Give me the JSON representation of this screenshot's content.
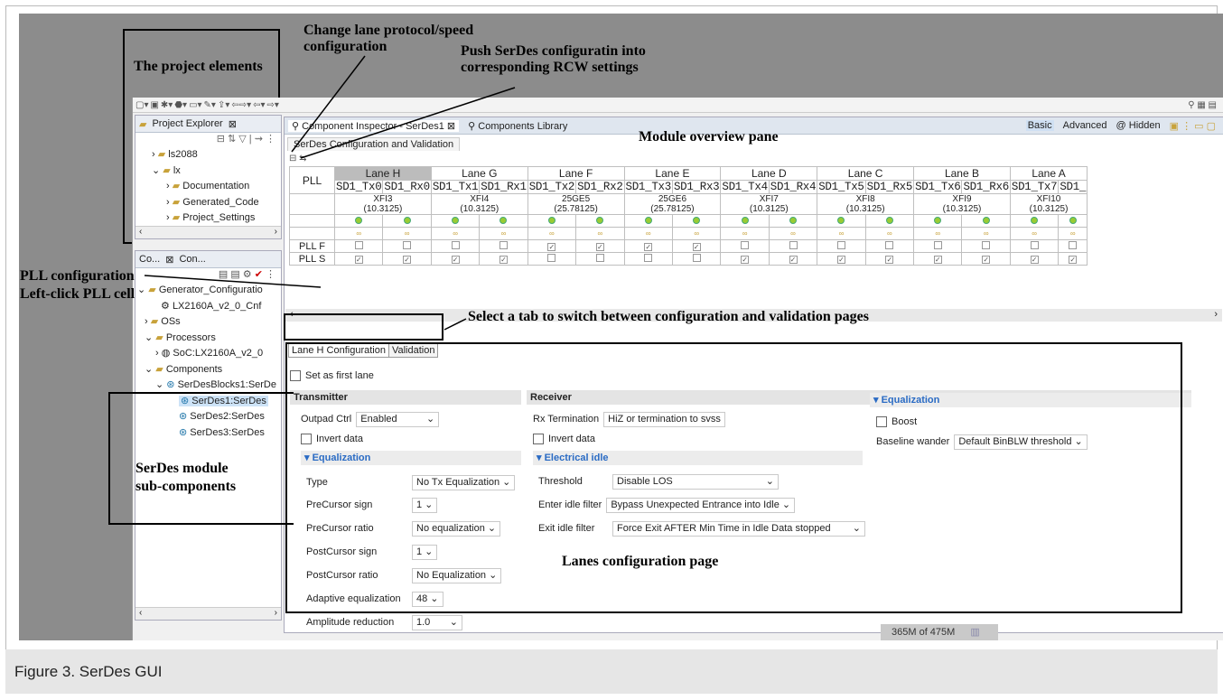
{
  "annotations": {
    "project_elements": "The project elements",
    "change_lane": "Change lane protocol/speed\nconfiguration",
    "push_serdes": "Push SerDes configuratin into\ncorresponding RCW settings",
    "module_overview": "Module overview pane",
    "pll_config": "PLL configuration\nLeft-click PLL cell",
    "select_tab": "Select a tab to switch between configuration and validation pages",
    "serdes_sub": "SerDes module\nsub-components",
    "lanes_page": "Lanes configuration page"
  },
  "project_explorer": {
    "tab_label": "Project Explorer",
    "items": [
      "ls2088",
      "lx",
      "Documentation",
      "Generated_Code",
      "Project_Settings"
    ]
  },
  "components_panel": {
    "tab1": "Co...",
    "tab2": "Con...",
    "items": [
      "Generator_Configuratio",
      "LX2160A_v2_0_Cnf",
      "OSs",
      "Processors",
      "SoC:LX2160A_v2_0",
      "Components",
      "SerDesBlocks1:SerDe",
      "SerDes1:SerDes",
      "SerDes2:SerDes",
      "SerDes3:SerDes"
    ]
  },
  "editor": {
    "tab_inspector": "Component Inspector - SerDes1",
    "tab_library": "Components Library",
    "view_basic": "Basic",
    "view_advanced": "Advanced",
    "view_hidden": "@ Hidden",
    "page_tab": "SerDes Configuration and Validation"
  },
  "pll_table": {
    "pll_header": "PLL",
    "lanes": [
      {
        "name": "Lane H",
        "tx": "SD1_Tx0",
        "rx": "SD1_Rx0",
        "proto": "XFI3",
        "speed": "(10.3125)",
        "pllf": [
          false,
          false
        ],
        "plls": [
          true,
          true
        ]
      },
      {
        "name": "Lane G",
        "tx": "SD1_Tx1",
        "rx": "SD1_Rx1",
        "proto": "XFI4",
        "speed": "(10.3125)",
        "pllf": [
          false,
          false
        ],
        "plls": [
          true,
          true
        ]
      },
      {
        "name": "Lane F",
        "tx": "SD1_Tx2",
        "rx": "SD1_Rx2",
        "proto": "25GE5",
        "speed": "(25.78125)",
        "pllf": [
          true,
          true
        ],
        "plls": [
          false,
          false
        ]
      },
      {
        "name": "Lane E",
        "tx": "SD1_Tx3",
        "rx": "SD1_Rx3",
        "proto": "25GE6",
        "speed": "(25.78125)",
        "pllf": [
          true,
          true
        ],
        "plls": [
          false,
          false
        ]
      },
      {
        "name": "Lane D",
        "tx": "SD1_Tx4",
        "rx": "SD1_Rx4",
        "proto": "XFI7",
        "speed": "(10.3125)",
        "pllf": [
          false,
          false
        ],
        "plls": [
          true,
          true
        ]
      },
      {
        "name": "Lane C",
        "tx": "SD1_Tx5",
        "rx": "SD1_Rx5",
        "proto": "XFI8",
        "speed": "(10.3125)",
        "pllf": [
          false,
          false
        ],
        "plls": [
          true,
          true
        ]
      },
      {
        "name": "Lane B",
        "tx": "SD1_Tx6",
        "rx": "SD1_Rx6",
        "proto": "XFI9",
        "speed": "(10.3125)",
        "pllf": [
          false,
          false
        ],
        "plls": [
          true,
          true
        ]
      },
      {
        "name": "Lane A",
        "tx": "SD1_Tx7",
        "rx": "SD1_",
        "proto": "XFI10",
        "speed": "(10.3125)",
        "pllf": [
          false,
          false
        ],
        "plls": [
          true,
          true
        ]
      }
    ],
    "pll_f": "PLL F",
    "pll_s": "PLL S"
  },
  "lane_tabs": {
    "config": "Lane H Configuration",
    "validation": "Validation"
  },
  "lane_config": {
    "first_lane": "Set as first lane",
    "transmitter": "Transmitter",
    "receiver": "Receiver",
    "outpad_label": "Outpad Ctrl",
    "outpad_value": "Enabled",
    "invert_tx": "Invert data",
    "eq_tx": "Equalization",
    "type_label": "Type",
    "type_value": "No Tx Equalization",
    "pre_sign_label": "PreCursor sign",
    "pre_sign_value": "1",
    "pre_ratio_label": "PreCursor ratio",
    "pre_ratio_value": "No equalization",
    "post_sign_label": "PostCursor sign",
    "post_sign_value": "1",
    "post_ratio_label": "PostCursor ratio",
    "post_ratio_value": "No Equalization",
    "adapt_label": "Adaptive equalization",
    "adapt_value": "48",
    "amp_label": "Amplitude reduction",
    "amp_value": "1.0",
    "rxterm_label": "Rx Termination",
    "rxterm_value": "HiZ or termination to svss",
    "invert_rx": "Invert data",
    "elec_idle": "Electrical idle",
    "threshold_label": "Threshold",
    "threshold_value": "Disable LOS",
    "enter_label": "Enter idle filter",
    "enter_value": "Bypass Unexpected Entrance into Idle",
    "exit_label": "Exit idle filter",
    "exit_value": "Force Exit AFTER Min Time in Idle Data stopped",
    "eq_rx": "Equalization",
    "boost": "Boost",
    "baseline_label": "Baseline wander",
    "baseline_value": "Default BinBLW threshold"
  },
  "status": {
    "memory": "365M of 475M"
  },
  "caption": "Figure 3. SerDes GUI"
}
